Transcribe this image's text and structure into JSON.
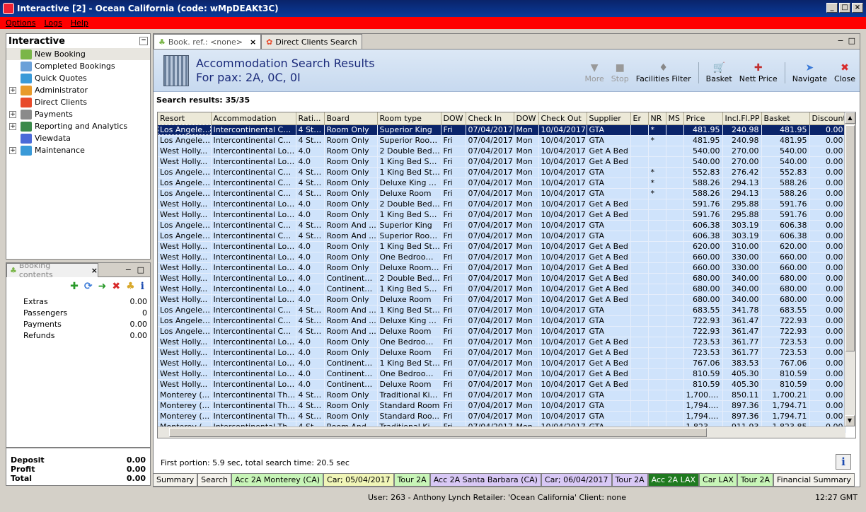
{
  "window": {
    "title": "Interactive [2] - Ocean California (code: wMpDEAKt3C)"
  },
  "menu": [
    "Options",
    "Logs",
    "Help"
  ],
  "nav": {
    "title": "Interactive",
    "items": [
      {
        "label": "New Booking",
        "expandable": false,
        "color": "#7ab648",
        "selected": true
      },
      {
        "label": "Completed Bookings",
        "expandable": false,
        "color": "#6aa0d8"
      },
      {
        "label": "Quick Quotes",
        "expandable": false,
        "color": "#3a9ad8"
      },
      {
        "label": "Administrator",
        "expandable": true,
        "color": "#e89a2a"
      },
      {
        "label": "Direct Clients",
        "expandable": false,
        "color": "#e84a2a"
      },
      {
        "label": "Payments",
        "expandable": true,
        "color": "#8a8a8a"
      },
      {
        "label": "Reporting and Analytics",
        "expandable": true,
        "color": "#3a8a4a"
      },
      {
        "label": "Viewdata",
        "expandable": false,
        "color": "#4a6ad8"
      },
      {
        "label": "Maintenance",
        "expandable": true,
        "color": "#3a9ad8"
      }
    ]
  },
  "booking_contents": {
    "tab_label": "Booking contents",
    "rows": [
      {
        "label": "Extras",
        "value": "0.00"
      },
      {
        "label": "Passengers",
        "value": "0"
      },
      {
        "label": "Payments",
        "value": "0.00"
      },
      {
        "label": "Refunds",
        "value": "0.00"
      }
    ]
  },
  "totals": [
    {
      "label": "Deposit",
      "value": "0.00"
    },
    {
      "label": "Profit",
      "value": "0.00"
    },
    {
      "label": "Total",
      "value": "0.00"
    }
  ],
  "tabs": [
    {
      "label": "Book. ref.: <none>",
      "active": true
    },
    {
      "label": "Direct Clients Search",
      "active": false
    }
  ],
  "header": {
    "title": "Accommodation Search Results",
    "subtitle": "For pax: 2A, 0C, 0I"
  },
  "toolbar": [
    {
      "label": "More",
      "icon": "▼",
      "disabled": true
    },
    {
      "label": "Stop",
      "icon": "■",
      "disabled": true
    },
    {
      "label": "Facilities Filter",
      "icon": "♦",
      "disabled": false
    },
    {
      "label": "Basket",
      "icon": "🛒",
      "disabled": false
    },
    {
      "label": "Nett Price",
      "icon": "✚",
      "disabled": false
    },
    {
      "label": "Navigate",
      "icon": "➤",
      "disabled": false
    },
    {
      "label": "Close",
      "icon": "✖",
      "disabled": false
    }
  ],
  "results_label": "Search results: 35/35",
  "grid": {
    "columns": [
      "Resort",
      "Accommodation",
      "Rati...",
      "Board",
      "Room type",
      "DOW",
      "Check In",
      "DOW",
      "Check Out",
      "Supplier",
      "Er",
      "NR",
      "MS",
      "Price",
      "Incl.Fl.PP",
      "Basket",
      "Discount"
    ],
    "rows": [
      [
        "Los Angeles...",
        "Intercontinental Cen...",
        "4 Stars",
        "Room Only",
        "Superior King",
        "Fri",
        "07/04/2017",
        "Mon",
        "10/04/2017",
        "GTA",
        "",
        "*",
        "",
        "481.95",
        "240.98",
        "481.95",
        "0.00"
      ],
      [
        "Los Angeles...",
        "Intercontinental Cen...",
        "4 Stars",
        "Room Only",
        "Superior Room...",
        "Fri",
        "07/04/2017",
        "Mon",
        "10/04/2017",
        "GTA",
        "",
        "*",
        "",
        "481.95",
        "240.98",
        "481.95",
        "0.00"
      ],
      [
        "West Holly...",
        "Intercontinental Los ...",
        "4.0",
        "Room Only",
        "2 Double Bed S...",
        "Fri",
        "07/04/2017",
        "Mon",
        "10/04/2017",
        "Get A Bed",
        "",
        "",
        "",
        "540.00",
        "270.00",
        "540.00",
        "0.00"
      ],
      [
        "West Holly...",
        "Intercontinental Los ...",
        "4.0",
        "Room Only",
        "1 King Bed Sup...",
        "Fri",
        "07/04/2017",
        "Mon",
        "10/04/2017",
        "Get A Bed",
        "",
        "",
        "",
        "540.00",
        "270.00",
        "540.00",
        "0.00"
      ],
      [
        "Los Angeles...",
        "Intercontinental Cen...",
        "4 Stars",
        "Room Only",
        "1 King Bed Stu...",
        "Fri",
        "07/04/2017",
        "Mon",
        "10/04/2017",
        "GTA",
        "",
        "*",
        "",
        "552.83",
        "276.42",
        "552.83",
        "0.00"
      ],
      [
        "Los Angeles...",
        "Intercontinental Cen...",
        "4 Stars",
        "Room Only",
        "Deluxe King Suite",
        "Fri",
        "07/04/2017",
        "Mon",
        "10/04/2017",
        "GTA",
        "",
        "*",
        "",
        "588.26",
        "294.13",
        "588.26",
        "0.00"
      ],
      [
        "Los Angeles...",
        "Intercontinental Cen...",
        "4 Stars",
        "Room Only",
        "Deluxe Room",
        "Fri",
        "07/04/2017",
        "Mon",
        "10/04/2017",
        "GTA",
        "",
        "*",
        "",
        "588.26",
        "294.13",
        "588.26",
        "0.00"
      ],
      [
        "West Holly...",
        "Intercontinental Los ...",
        "4.0",
        "Room Only",
        "2 Double Bed S...",
        "Fri",
        "07/04/2017",
        "Mon",
        "10/04/2017",
        "Get A Bed",
        "",
        "",
        "",
        "591.76",
        "295.88",
        "591.76",
        "0.00"
      ],
      [
        "West Holly...",
        "Intercontinental Los ...",
        "4.0",
        "Room Only",
        "1 King Bed Sup...",
        "Fri",
        "07/04/2017",
        "Mon",
        "10/04/2017",
        "Get A Bed",
        "",
        "",
        "",
        "591.76",
        "295.88",
        "591.76",
        "0.00"
      ],
      [
        "Los Angeles...",
        "Intercontinental Cen...",
        "4 Stars",
        "Room And ...",
        "Superior King",
        "Fri",
        "07/04/2017",
        "Mon",
        "10/04/2017",
        "GTA",
        "",
        "",
        "",
        "606.38",
        "303.19",
        "606.38",
        "0.00"
      ],
      [
        "Los Angeles...",
        "Intercontinental Cen...",
        "4 Stars",
        "Room And ...",
        "Superior Room...",
        "Fri",
        "07/04/2017",
        "Mon",
        "10/04/2017",
        "GTA",
        "",
        "",
        "",
        "606.38",
        "303.19",
        "606.38",
        "0.00"
      ],
      [
        "West Holly...",
        "Intercontinental Los ...",
        "4.0",
        "Room Only",
        "1 King Bed Stu...",
        "Fri",
        "07/04/2017",
        "Mon",
        "10/04/2017",
        "Get A Bed",
        "",
        "",
        "",
        "620.00",
        "310.00",
        "620.00",
        "0.00"
      ],
      [
        "West Holly...",
        "Intercontinental Los ...",
        "4.0",
        "Room Only",
        "One Bedroom ...",
        "Fri",
        "07/04/2017",
        "Mon",
        "10/04/2017",
        "Get A Bed",
        "",
        "",
        "",
        "660.00",
        "330.00",
        "660.00",
        "0.00"
      ],
      [
        "West Holly...",
        "Intercontinental Los ...",
        "4.0",
        "Room Only",
        "Deluxe Room (...",
        "Fri",
        "07/04/2017",
        "Mon",
        "10/04/2017",
        "Get A Bed",
        "",
        "",
        "",
        "660.00",
        "330.00",
        "660.00",
        "0.00"
      ],
      [
        "West Holly...",
        "Intercontinental Los ...",
        "4.0",
        "Continental...",
        "2 Double Bed S...",
        "Fri",
        "07/04/2017",
        "Mon",
        "10/04/2017",
        "Get A Bed",
        "",
        "",
        "",
        "680.00",
        "340.00",
        "680.00",
        "0.00"
      ],
      [
        "West Holly...",
        "Intercontinental Los ...",
        "4.0",
        "Continental...",
        "1 King Bed Sup...",
        "Fri",
        "07/04/2017",
        "Mon",
        "10/04/2017",
        "Get A Bed",
        "",
        "",
        "",
        "680.00",
        "340.00",
        "680.00",
        "0.00"
      ],
      [
        "West Holly...",
        "Intercontinental Los ...",
        "4.0",
        "Room Only",
        "Deluxe Room",
        "Fri",
        "07/04/2017",
        "Mon",
        "10/04/2017",
        "Get A Bed",
        "",
        "",
        "",
        "680.00",
        "340.00",
        "680.00",
        "0.00"
      ],
      [
        "Los Angeles...",
        "Intercontinental Cen...",
        "4 Stars",
        "Room And ...",
        "1 King Bed Stu...",
        "Fri",
        "07/04/2017",
        "Mon",
        "10/04/2017",
        "GTA",
        "",
        "",
        "",
        "683.55",
        "341.78",
        "683.55",
        "0.00"
      ],
      [
        "Los Angeles...",
        "Intercontinental Cen...",
        "4 Stars",
        "Room And ...",
        "Deluxe King Suite",
        "Fri",
        "07/04/2017",
        "Mon",
        "10/04/2017",
        "GTA",
        "",
        "",
        "",
        "722.93",
        "361.47",
        "722.93",
        "0.00"
      ],
      [
        "Los Angeles...",
        "Intercontinental Cen...",
        "4 Stars",
        "Room And ...",
        "Deluxe Room",
        "Fri",
        "07/04/2017",
        "Mon",
        "10/04/2017",
        "GTA",
        "",
        "",
        "",
        "722.93",
        "361.47",
        "722.93",
        "0.00"
      ],
      [
        "West Holly...",
        "Intercontinental Los ...",
        "4.0",
        "Room Only",
        "One Bedroom ...",
        "Fri",
        "07/04/2017",
        "Mon",
        "10/04/2017",
        "Get A Bed",
        "",
        "",
        "",
        "723.53",
        "361.77",
        "723.53",
        "0.00"
      ],
      [
        "West Holly...",
        "Intercontinental Los ...",
        "4.0",
        "Room Only",
        "Deluxe Room",
        "Fri",
        "07/04/2017",
        "Mon",
        "10/04/2017",
        "Get A Bed",
        "",
        "",
        "",
        "723.53",
        "361.77",
        "723.53",
        "0.00"
      ],
      [
        "West Holly...",
        "Intercontinental Los ...",
        "4.0",
        "Continental...",
        "1 King Bed Stu...",
        "Fri",
        "07/04/2017",
        "Mon",
        "10/04/2017",
        "Get A Bed",
        "",
        "",
        "",
        "767.06",
        "383.53",
        "767.06",
        "0.00"
      ],
      [
        "West Holly...",
        "Intercontinental Los ...",
        "4.0",
        "Continental...",
        "One Bedroom ...",
        "Fri",
        "07/04/2017",
        "Mon",
        "10/04/2017",
        "Get A Bed",
        "",
        "",
        "",
        "810.59",
        "405.30",
        "810.59",
        "0.00"
      ],
      [
        "West Holly...",
        "Intercontinental Los ...",
        "4.0",
        "Continental...",
        "Deluxe Room",
        "Fri",
        "07/04/2017",
        "Mon",
        "10/04/2017",
        "Get A Bed",
        "",
        "",
        "",
        "810.59",
        "405.30",
        "810.59",
        "0.00"
      ],
      [
        "Monterey (...",
        "Intercontinental The ...",
        "4 Stars",
        "Room Only",
        "Traditional Kin...",
        "Fri",
        "07/04/2017",
        "Mon",
        "10/04/2017",
        "GTA",
        "",
        "",
        "",
        "1,700.21",
        "850.11",
        "1,700.21",
        "0.00"
      ],
      [
        "Monterey (...",
        "Intercontinental The ...",
        "4 Stars",
        "Room Only",
        "Standard Room",
        "Fri",
        "07/04/2017",
        "Mon",
        "10/04/2017",
        "GTA",
        "",
        "",
        "",
        "1,794.71",
        "897.36",
        "1,794.71",
        "0.00"
      ],
      [
        "Monterey (...",
        "Intercontinental The ...",
        "4 Stars",
        "Room Only",
        "Standard Roo...",
        "Fri",
        "07/04/2017",
        "Mon",
        "10/04/2017",
        "GTA",
        "",
        "",
        "",
        "1,794.71",
        "897.36",
        "1,794.71",
        "0.00"
      ],
      [
        "Monterey (...",
        "Intercontinental The ...",
        "4 Stars",
        "Room And ...",
        "Traditional Kin...",
        "Fri",
        "07/04/2017",
        "Mon",
        "10/04/2017",
        "GTA",
        "",
        "",
        "",
        "1,823.85",
        "911.93",
        "1,823.85",
        "0.00"
      ]
    ]
  },
  "first_portion": "First portion: 5.9 sec, total search time: 20.5 sec",
  "bottom_tabs": [
    {
      "label": "Summary",
      "bg": "#f4f2ec",
      "color": "#000"
    },
    {
      "label": "Search",
      "bg": "#f4f2ec",
      "color": "#000"
    },
    {
      "label": "Acc 2A Monterey (CA)",
      "bg": "#c8f5b8",
      "color": "#000"
    },
    {
      "label": "Car; 05/04/2017",
      "bg": "#f0f5b8",
      "color": "#000"
    },
    {
      "label": "Tour 2A",
      "bg": "#c8f5b8",
      "color": "#000"
    },
    {
      "label": "Acc 2A Santa Barbara (CA)",
      "bg": "#d8c8f5",
      "color": "#000"
    },
    {
      "label": "Car; 06/04/2017",
      "bg": "#d8c8f5",
      "color": "#000"
    },
    {
      "label": "Tour 2A",
      "bg": "#d8c8f5",
      "color": "#000"
    },
    {
      "label": "Acc 2A LAX",
      "bg": "#1f7a1f",
      "color": "#fff"
    },
    {
      "label": "Car LAX",
      "bg": "#c8f5b8",
      "color": "#000"
    },
    {
      "label": "Tour 2A",
      "bg": "#c8f5b8",
      "color": "#000"
    },
    {
      "label": "Financial Summary",
      "bg": "#f4f2ec",
      "color": "#000"
    }
  ],
  "status": {
    "user": "User: 263 - Anthony Lynch    Retailer: 'Ocean California'    Client: none",
    "time": "12:27 GMT"
  }
}
